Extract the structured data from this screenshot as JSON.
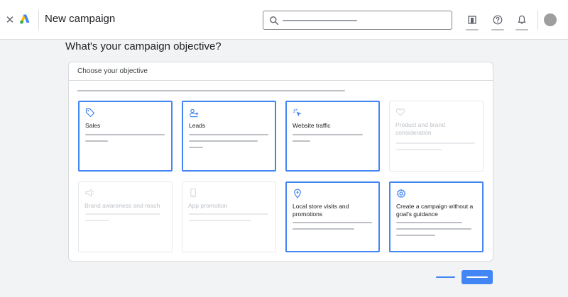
{
  "header": {
    "title": "New campaign",
    "close_icon": "close-icon",
    "logo_icon": "google-ads-logo",
    "actions": [
      "tools-icon",
      "help-icon",
      "notifications-icon"
    ]
  },
  "page": {
    "title": "What's your campaign objective?"
  },
  "panel": {
    "header": "Choose your objective"
  },
  "objectives": [
    {
      "label": "Sales",
      "icon": "tag-icon",
      "enabled": true
    },
    {
      "label": "Leads",
      "icon": "leads-icon",
      "enabled": true
    },
    {
      "label": "Website traffic",
      "icon": "cursor-click-icon",
      "enabled": true
    },
    {
      "label": "Product and brand consideration",
      "icon": "heart-icon",
      "enabled": false
    },
    {
      "label": "Brand awareness and reach",
      "icon": "megaphone-icon",
      "enabled": false
    },
    {
      "label": "App promotion",
      "icon": "phone-icon",
      "enabled": false
    },
    {
      "label": "Local store visits and promotions",
      "icon": "location-pin-icon",
      "enabled": true
    },
    {
      "label": "Create a campaign without a goal's guidance",
      "icon": "gear-icon",
      "enabled": true
    }
  ],
  "colors": {
    "accent": "#4285f4",
    "text": "#202124",
    "disabled_text": "#bdc1c6",
    "background": "#f1f3f4"
  }
}
